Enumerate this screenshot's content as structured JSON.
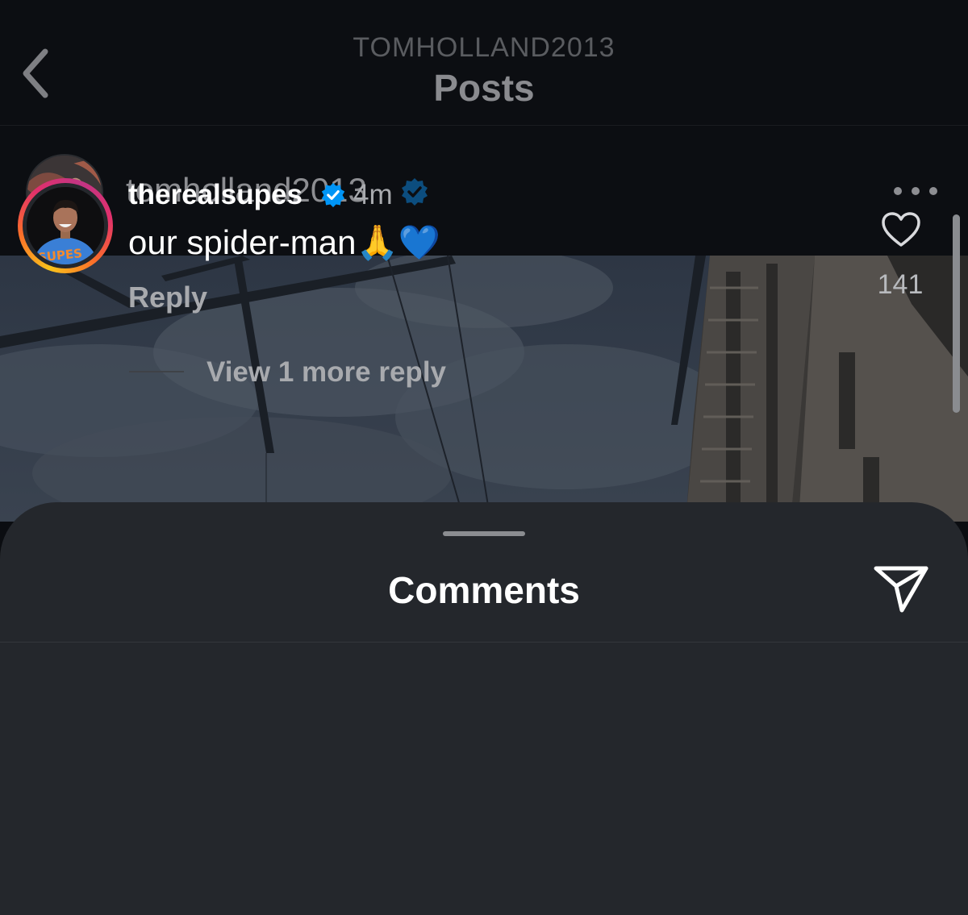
{
  "header": {
    "subtitle": "TOMHOLLAND2013",
    "title": "Posts"
  },
  "post": {
    "author": "tomholland2013",
    "author_verified": true
  },
  "comments_sheet": {
    "title": "Comments",
    "comments": [
      {
        "username": "therealsupes",
        "verified": true,
        "time": "4m",
        "text": "our spider-man🙏💙",
        "reply_label": "Reply",
        "like_count": "141",
        "view_replies_label": "View 1 more reply"
      }
    ]
  },
  "icons": {
    "back": "chevron-left-icon",
    "more": "more-horizontal-icon",
    "verified": "verified-badge-icon",
    "share": "paper-plane-icon",
    "like": "heart-outline-icon"
  },
  "colors": {
    "verified_blue": "#0095f6",
    "sheet_background": "#24272c",
    "page_background": "#0c0e12"
  }
}
